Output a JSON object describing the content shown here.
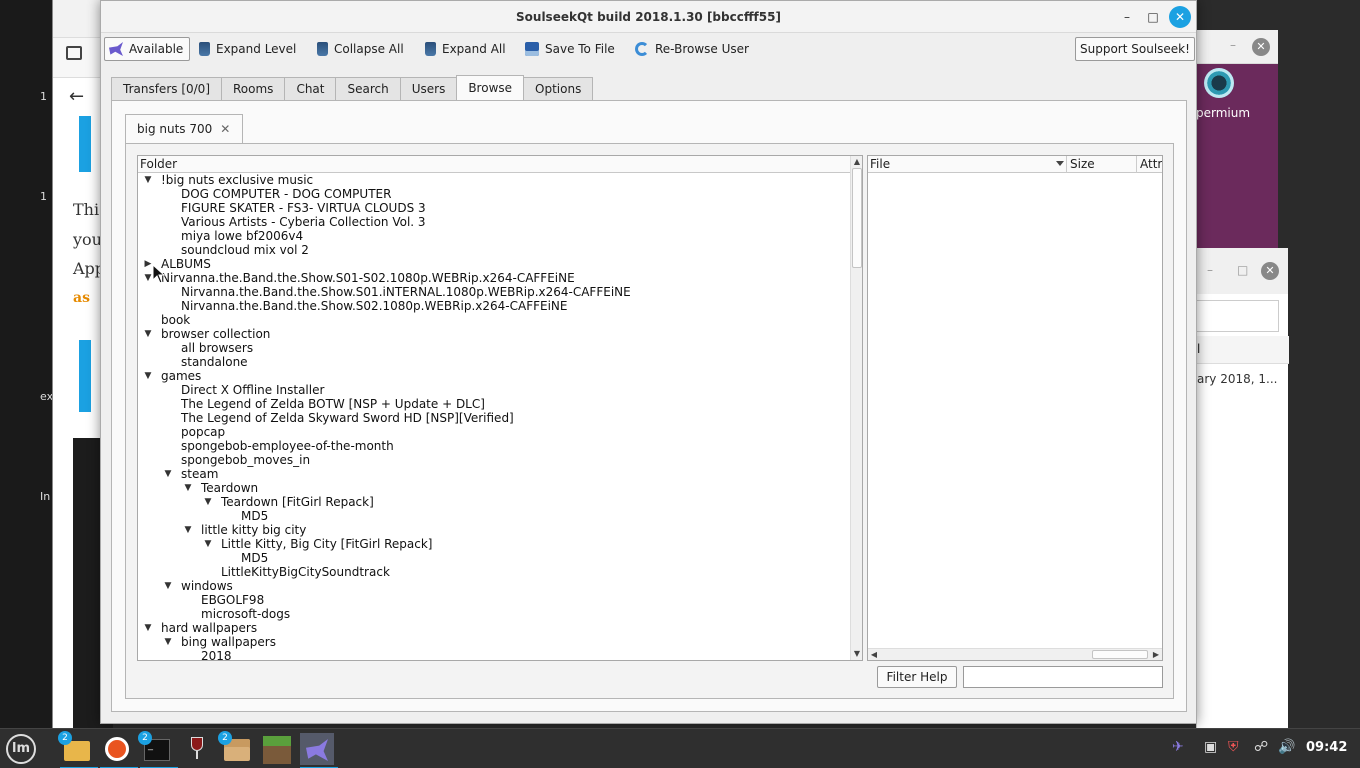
{
  "window": {
    "title": "SoulseekQt build 2018.1.30 [bbccfff55]"
  },
  "toolbar": {
    "status_label": "Available",
    "expand_level_label": "Expand Level",
    "collapse_all_label": "Collapse All",
    "expand_all_label": "Expand All",
    "save_to_file_label": "Save To File",
    "rebrowse_label": "Re-Browse User",
    "support_label": "Support Soulseek!"
  },
  "tabs": [
    {
      "label": "Transfers [0/0]"
    },
    {
      "label": "Rooms"
    },
    {
      "label": "Chat"
    },
    {
      "label": "Search"
    },
    {
      "label": "Users"
    },
    {
      "label": "Browse",
      "active": true
    },
    {
      "label": "Options"
    }
  ],
  "browse": {
    "user_tab_label": "big nuts 700",
    "folder_header": "Folder",
    "file_headers": [
      "File",
      "Size",
      "Attr"
    ],
    "filter_button_label": "Filter Help",
    "filter_value": "",
    "tree": [
      {
        "label": "!big nuts exclusive music",
        "depth": 0,
        "state": "expanded"
      },
      {
        "label": "DOG COMPUTER - DOG COMPUTER",
        "depth": 1,
        "state": "leaf"
      },
      {
        "label": "FIGURE SKATER - FS3- VIRTUA CLOUDS 3",
        "depth": 1,
        "state": "leaf"
      },
      {
        "label": "Various Artists - Cyberia Collection Vol. 3",
        "depth": 1,
        "state": "leaf"
      },
      {
        "label": "miya lowe bf2006v4",
        "depth": 1,
        "state": "leaf"
      },
      {
        "label": "soundcloud mix vol 2",
        "depth": 1,
        "state": "leaf"
      },
      {
        "label": "ALBUMS",
        "depth": 0,
        "state": "collapsed"
      },
      {
        "label": "Nirvanna.the.Band.the.Show.S01-S02.1080p.WEBRip.x264-CAFFEiNE",
        "depth": 0,
        "state": "expanded"
      },
      {
        "label": "Nirvanna.the.Band.the.Show.S01.iNTERNAL.1080p.WEBRip.x264-CAFFEiNE",
        "depth": 1,
        "state": "leaf"
      },
      {
        "label": "Nirvanna.the.Band.the.Show.S02.1080p.WEBRip.x264-CAFFEiNE",
        "depth": 1,
        "state": "leaf"
      },
      {
        "label": "book",
        "depth": 0,
        "state": "leaf"
      },
      {
        "label": "browser collection",
        "depth": 0,
        "state": "expanded"
      },
      {
        "label": "all browsers",
        "depth": 1,
        "state": "leaf"
      },
      {
        "label": "standalone",
        "depth": 1,
        "state": "leaf"
      },
      {
        "label": "games",
        "depth": 0,
        "state": "expanded"
      },
      {
        "label": "Direct X Offline Installer",
        "depth": 1,
        "state": "leaf"
      },
      {
        "label": "The Legend of Zelda BOTW [NSP + Update + DLC]",
        "depth": 1,
        "state": "leaf"
      },
      {
        "label": "The Legend of Zelda Skyward Sword HD [NSP][Verified]",
        "depth": 1,
        "state": "leaf"
      },
      {
        "label": "popcap",
        "depth": 1,
        "state": "leaf"
      },
      {
        "label": "spongebob-employee-of-the-month",
        "depth": 1,
        "state": "leaf"
      },
      {
        "label": "spongebob_moves_in",
        "depth": 1,
        "state": "leaf"
      },
      {
        "label": "steam",
        "depth": 1,
        "state": "expanded"
      },
      {
        "label": "Teardown",
        "depth": 2,
        "state": "expanded"
      },
      {
        "label": "Teardown [FitGirl Repack]",
        "depth": 3,
        "state": "expanded"
      },
      {
        "label": "MD5",
        "depth": 4,
        "state": "leaf"
      },
      {
        "label": "little kitty big city",
        "depth": 2,
        "state": "expanded"
      },
      {
        "label": "Little Kitty, Big City [FitGirl Repack]",
        "depth": 3,
        "state": "expanded"
      },
      {
        "label": "MD5",
        "depth": 4,
        "state": "leaf"
      },
      {
        "label": "LittleKittyBigCitySoundtrack",
        "depth": 3,
        "state": "leaf"
      },
      {
        "label": "windows",
        "depth": 1,
        "state": "expanded"
      },
      {
        "label": "EBGOLF98",
        "depth": 2,
        "state": "leaf"
      },
      {
        "label": "microsoft-dogs",
        "depth": 2,
        "state": "leaf"
      },
      {
        "label": "hard wallpapers",
        "depth": 0,
        "state": "expanded"
      },
      {
        "label": "bing wallpapers",
        "depth": 1,
        "state": "expanded"
      },
      {
        "label": "2018",
        "depth": 2,
        "state": "leaf"
      }
    ]
  },
  "background": {
    "browser_text": [
      "Thi",
      "you",
      "App",
      "as"
    ],
    "left_text": [
      "1",
      "1",
      "ex",
      "In"
    ],
    "purple_window_label": "permium",
    "file_window_header": "l",
    "file_window_row": "ary 2018, 1..."
  },
  "taskbar": {
    "clock": "09:42",
    "badges": [
      "2",
      "2",
      "2"
    ]
  },
  "colors": {
    "accent": "#1ba1e2",
    "taskbar": "#2f2f2f",
    "window_bg": "#efefef"
  }
}
